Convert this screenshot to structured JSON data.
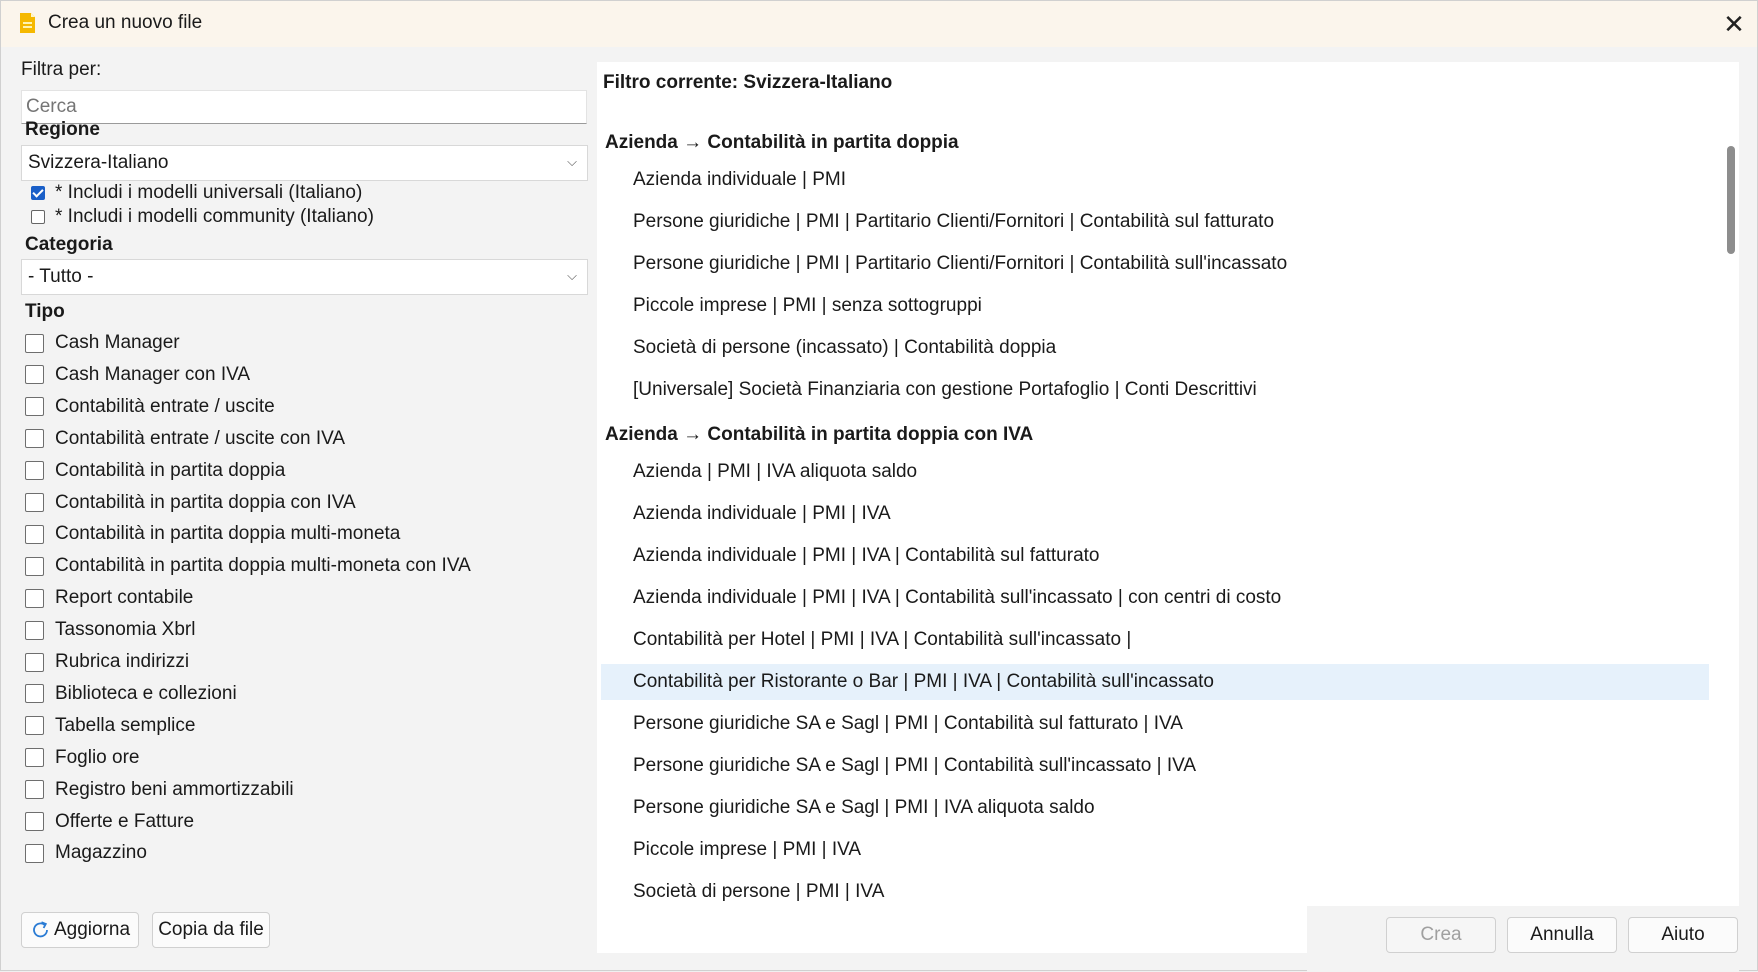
{
  "window": {
    "title": "Crea un nuovo file"
  },
  "filter": {
    "label": "Filtra per:",
    "search_placeholder": "Cerca",
    "region_label": "Regione",
    "region_value": "Svizzera-Italiano",
    "include_universal": "* Includi i modelli universali (Italiano)",
    "include_community": "* Includi i modelli community (Italiano)",
    "category_label": "Categoria",
    "category_value": "- Tutto -",
    "type_label": "Tipo",
    "types": [
      "Cash Manager",
      "Cash Manager con IVA",
      "Contabilità entrate / uscite",
      "Contabilità entrate / uscite con IVA",
      "Contabilità in partita doppia",
      "Contabilità in partita doppia con IVA",
      "Contabilità in partita doppia multi-moneta",
      "Contabilità in partita doppia multi-moneta con IVA",
      "Report contabile",
      "Tassonomia Xbrl",
      "Rubrica indirizzi",
      "Biblioteca e collezioni",
      "Tabella semplice",
      "Foglio ore",
      "Registro beni ammortizzabili",
      "Offerte e Fatture",
      "Magazzino"
    ]
  },
  "buttons": {
    "refresh": "Aggiorna",
    "copy": "Copia da file",
    "create": "Crea",
    "cancel": "Annulla",
    "help": "Aiuto"
  },
  "results": {
    "current_filter": "Filtro corrente: Svizzera-Italiano",
    "groups": [
      {
        "title": "Azienda → Contabilità in partita doppia",
        "items": [
          "Azienda individuale | PMI",
          "Persone giuridiche | PMI | Partitario Clienti/Fornitori | Contabilità sul fatturato",
          "Persone giuridiche | PMI | Partitario Clienti/Fornitori | Contabilità sull'incassato",
          "Piccole imprese | PMI | senza sottogruppi",
          "Società di persone (incassato) | Contabilità doppia",
          "[Universale] Società Finanziaria con gestione Portafoglio | Conti Descrittivi"
        ]
      },
      {
        "title": "Azienda → Contabilità in partita doppia con IVA",
        "items": [
          "Azienda | PMI | IVA aliquota saldo",
          "Azienda individuale | PMI | IVA",
          "Azienda individuale | PMI | IVA | Contabilità sul fatturato",
          "Azienda individuale | PMI | IVA | Contabilità sull'incassato | con centri di costo",
          "Contabilità per Hotel | PMI | IVA | Contabilità sull'incassato |",
          "Contabilità per Ristorante o Bar | PMI | IVA | Contabilità sull'incassato",
          "Persone giuridiche SA e Sagl | PMI | Contabilità sul fatturato | IVA",
          "Persone giuridiche SA e Sagl | PMI | Contabilità sull'incassato | IVA",
          "Persone giuridiche SA e Sagl | PMI | IVA aliquota saldo",
          "Piccole imprese | PMI | IVA",
          "Società di persone | PMI | IVA"
        ]
      }
    ],
    "selected_item": "Contabilità per Ristorante o Bar | PMI | IVA | Contabilità sull'incassato"
  }
}
